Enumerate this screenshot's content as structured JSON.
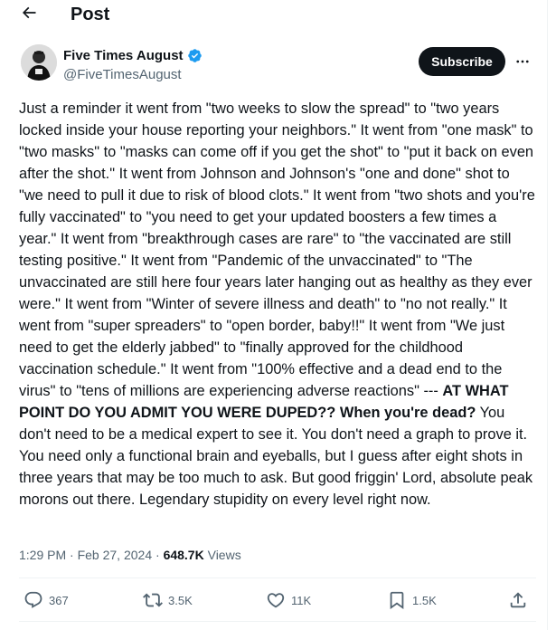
{
  "header": {
    "title": "Post"
  },
  "post": {
    "author_name": "Five Times August",
    "handle": "@FiveTimesAugust",
    "subscribe_label": "Subscribe",
    "text_part1": "Just a reminder it went from \"two weeks to slow the spread\" to \"two years locked inside your house reporting your neighbors.\" It went from \"one mask\" to \"two masks\" to \"masks can come off if you get the shot\" to \"put it back on even after the shot.\" It went from Johnson and Johnson's \"one and done\" shot to \"we need to pull it due to risk of blood clots.\" It went from \"two shots and you're fully vaccinated\" to \"you need to get your updated boosters a few times a year.\" It went from \"breakthrough cases are rare\" to \"the vaccinated are still testing positive.\" It went from \"Pandemic of the unvaccinated\" to \"The unvaccinated are still here four years later hanging out as healthy as they ever were.\" It went from \"Winter of severe illness and death\" to \"no not really.\" It went from \"super spreaders\" to \"open border, baby!!\" It went from \"We just need to get the elderly jabbed\" to \"finally approved for the childhood vaccination schedule.\" It went from \"100% effective and a dead end to the virus\" to \"tens of millions are experiencing adverse reactions\" --- ",
    "text_bold": "AT WHAT POINT DO YOU ADMIT YOU WERE DUPED?? When you're dead?",
    "text_part2": " You don't need to be a medical expert to see it. You don't need a graph to prove it. You need only a functional brain and eyeballs, but I guess after eight shots in three years that may be too much to ask. But good friggin' Lord, absolute peak morons out there. Legendary stupidity on every level right now.",
    "time": "1:29 PM",
    "separator": "·",
    "date": "Feb 27, 2024",
    "views_count": "648.7K",
    "views_label": "Views"
  },
  "actions": {
    "replies": "367",
    "reposts": "3.5K",
    "likes": "11K",
    "bookmarks": "1.5K"
  },
  "icons": {
    "back": "arrow-left-icon",
    "verified": "verified-badge-icon",
    "more": "more-horizontal-icon",
    "reply": "reply-icon",
    "repost": "repost-icon",
    "like": "heart-icon",
    "bookmark": "bookmark-icon",
    "share": "share-icon"
  },
  "colors": {
    "verified": "#1d9bf0",
    "text": "#0f1419",
    "secondary": "#536471",
    "button_bg": "#0f1419"
  }
}
